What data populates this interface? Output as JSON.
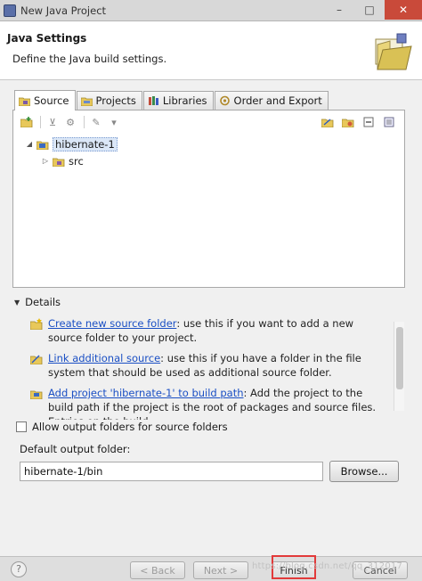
{
  "window": {
    "title": "New Java Project",
    "controls": {
      "minimize": "–",
      "maximize": "□",
      "close": "✕"
    }
  },
  "header": {
    "title": "Java Settings",
    "description": "Define the Java build settings."
  },
  "tabs": [
    {
      "label": "Source",
      "icon": "source-folder-icon",
      "active": true
    },
    {
      "label": "Projects",
      "icon": "projects-icon",
      "active": false
    },
    {
      "label": "Libraries",
      "icon": "libraries-icon",
      "active": false
    },
    {
      "label": "Order and Export",
      "icon": "order-export-icon",
      "active": false
    }
  ],
  "tree": {
    "project": "hibernate-1",
    "children": [
      "src"
    ]
  },
  "details": {
    "heading": "Details",
    "items": [
      {
        "link": "Create new source folder",
        "text": ": use this if you want to add a new source folder to your project."
      },
      {
        "link": "Link additional source",
        "text": ": use this if you have a folder in the file system that should be used as additional source folder."
      },
      {
        "link": "Add project 'hibernate-1' to build path",
        "text": ": Add the project to the build path if the project is the root of packages and source files. Entries on the build"
      }
    ]
  },
  "options": {
    "allow_output_folders": "Allow output folders for source folders",
    "allow_output_checked": false,
    "default_output_label": "Default output folder:",
    "default_output_value": "hibernate-1/bin",
    "browse_label": "Browse..."
  },
  "footer": {
    "help": "?",
    "back": "< Back",
    "next": "Next >",
    "finish": "Finish",
    "cancel": "Cancel",
    "watermark": "https://blog.csdn.net/qq_312017"
  },
  "colors": {
    "link": "#1a4fc4",
    "highlight": "#e23a3a",
    "selection": "#dbe7f7"
  }
}
